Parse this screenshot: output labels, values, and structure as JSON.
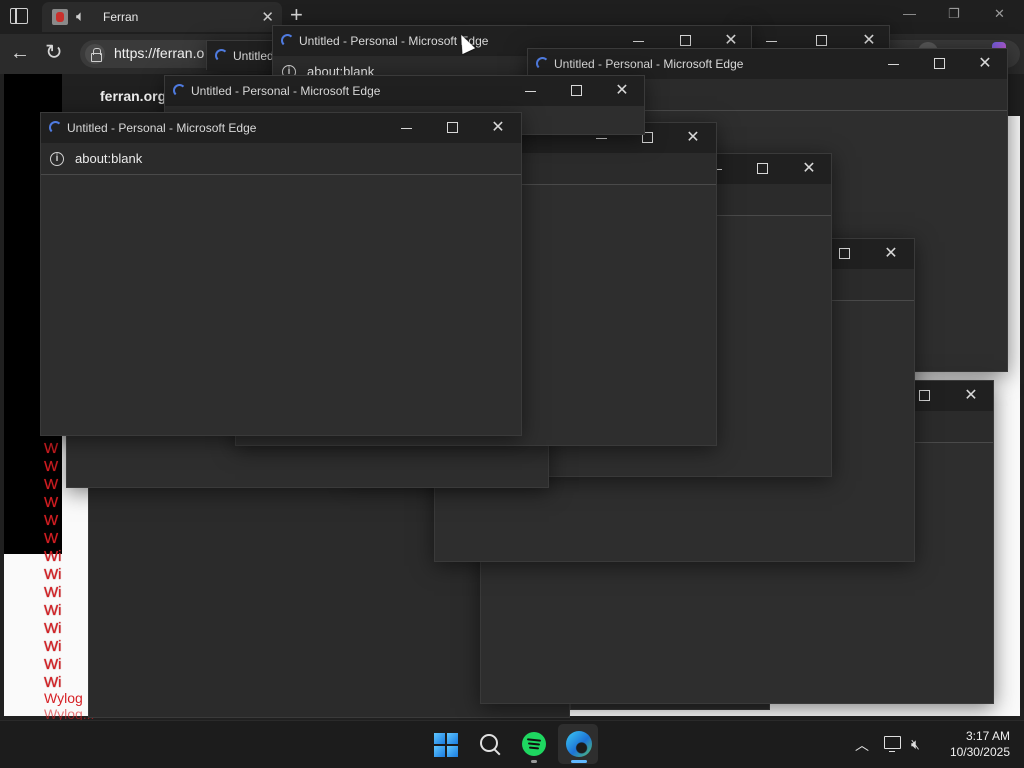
{
  "main_browser": {
    "tab_title": "Ferran",
    "url": "https://ferran.o",
    "site_name": "ferran.org",
    "partial_tab_label": "Untitled"
  },
  "background_text": {
    "w_items": [
      "W",
      "W",
      "W",
      "W",
      "W",
      "W",
      "Wi",
      "Wi",
      "Wi",
      "Wi",
      "Wi",
      "Wi",
      "Wi",
      "Wi"
    ],
    "last_line": "Wylog",
    "last_line2": "Wylog..."
  },
  "popup": {
    "title": "Untitled - Personal - Microsoft Edge",
    "address": "about:blank",
    "minimize_label": "—",
    "maximize_label": "",
    "close_label": "✕"
  },
  "taskbar": {
    "time": "3:17 AM",
    "date": "10/30/2025",
    "icons": [
      "windows-start-icon",
      "search-icon",
      "spotify-icon",
      "edge-icon"
    ]
  },
  "colors": {
    "accent": "#5fb8ff",
    "spotify": "#1ed760",
    "title_bar": "#202020",
    "window_body": "#2e2e2e",
    "error_text": "#d61f24"
  }
}
